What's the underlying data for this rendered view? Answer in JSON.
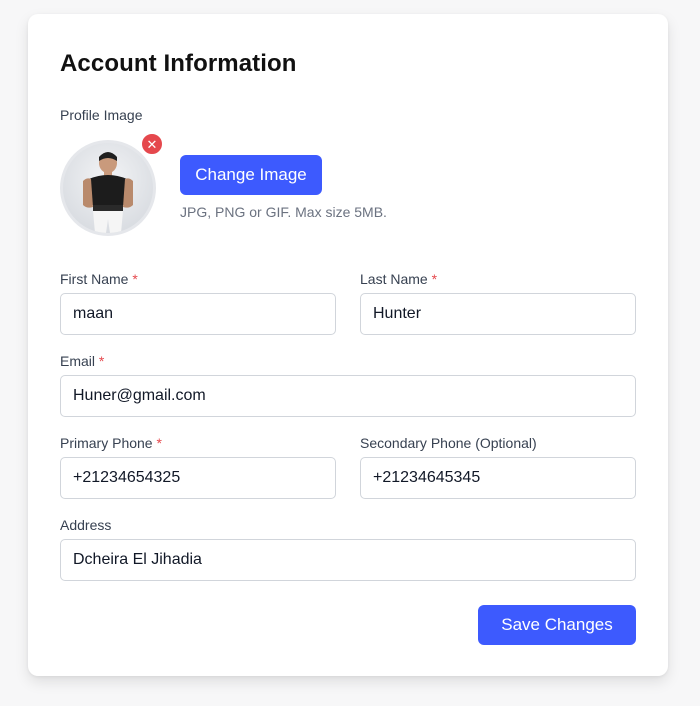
{
  "form": {
    "title": "Account Information",
    "profile_image_label": "Profile Image",
    "change_image_label": "Change Image",
    "remove_symbol": "✕",
    "hint": "JPG, PNG or GIF. Max size 5MB.",
    "required_mark": "*",
    "fields": {
      "first_name": {
        "label": "First Name",
        "value": "maan"
      },
      "last_name": {
        "label": "Last Name",
        "value": "Hunter"
      },
      "email": {
        "label": "Email",
        "value": "Huner@gmail.com"
      },
      "primary_phone": {
        "label": "Primary Phone",
        "value": "+21234654325"
      },
      "secondary_phone": {
        "label": "Secondary Phone (Optional)",
        "value": "+21234645345"
      },
      "address": {
        "label": "Address",
        "value": "Dcheira El Jihadia"
      }
    },
    "save_label": "Save Changes"
  },
  "colors": {
    "primary": "#3d5afe",
    "danger": "#e5484d",
    "border": "#d1d5db"
  }
}
